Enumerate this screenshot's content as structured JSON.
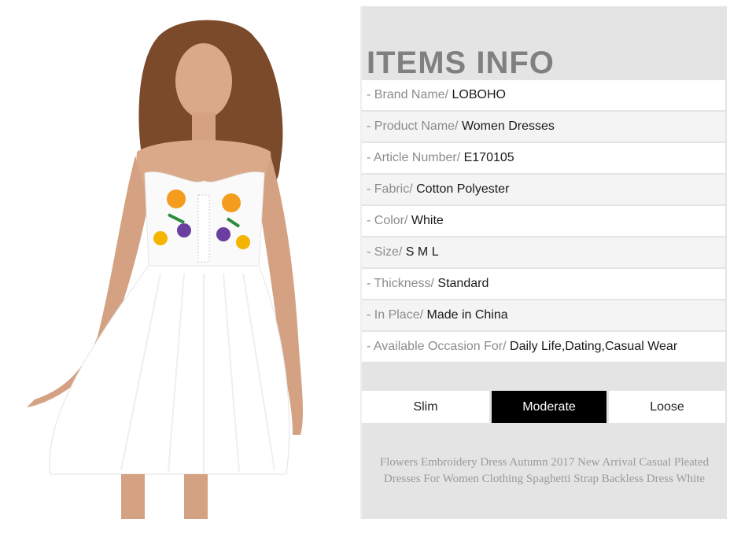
{
  "title": "ITEMS INFO",
  "rows": [
    {
      "label": "- Brand Name/ ",
      "value": "LOBOHO"
    },
    {
      "label": "- Product Name/ ",
      "value": "Women Dresses"
    },
    {
      "label": "- Article Number/ ",
      "value": "E170105"
    },
    {
      "label": "- Fabric/ ",
      "value": "Cotton Polyester"
    },
    {
      "label": "- Color/ ",
      "value": "White"
    },
    {
      "label": "- Size/ ",
      "value": "S M L"
    },
    {
      "label": "- Thickness/ ",
      "value": "Standard"
    },
    {
      "label": "- In Place/ ",
      "value": "Made in China"
    },
    {
      "label": "- Available Occasion For/ ",
      "value": "Daily Life,Dating,Casual Wear"
    }
  ],
  "fit": {
    "options": [
      "Slim",
      "Moderate",
      "Loose"
    ],
    "selected": "Moderate"
  },
  "description": "Flowers Embroidery Dress Autumn 2017 New Arrival Casual Pleated Dresses For Women Clothing Spaghetti Strap Backless Dress White",
  "colors": {
    "title": "#808080",
    "label": "#8c8c8c",
    "selected_bg": "#000000",
    "panel_bg": "#e4e4e4"
  }
}
